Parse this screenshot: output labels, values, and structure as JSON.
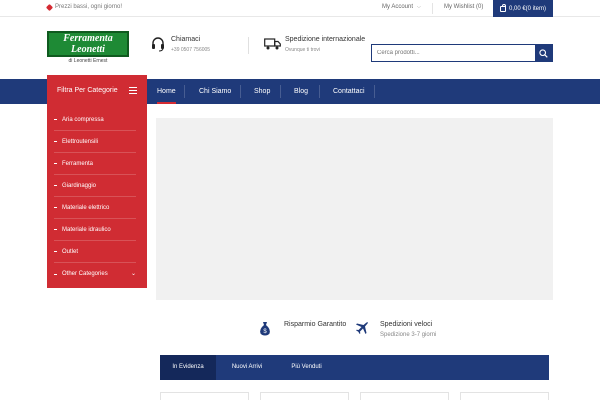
{
  "topbar": {
    "promo_text": "Prezzi bassi, ogni giorno!",
    "account_label": "My Account",
    "wishlist_label": "My Wishlist (0)",
    "cart_label": "0,00 €(0 item)"
  },
  "header": {
    "logo_line1": "Ferramenta",
    "logo_line2": "Leonetti",
    "logo_sub": "di Leonetti Ernest",
    "contact_title": "Chiamaci",
    "contact_phone": "+39 0507 756005",
    "shipping_title": "Spedizione internazionale",
    "shipping_sub": "Ovunque ti trovi",
    "search_placeholder": "Cerca prodotti..."
  },
  "nav": {
    "category_title": "Filtra Per Categorie",
    "items": [
      {
        "label": "Home"
      },
      {
        "label": "Chi Siamo"
      },
      {
        "label": "Shop"
      },
      {
        "label": "Blog"
      },
      {
        "label": "Contattaci"
      }
    ]
  },
  "categories": [
    {
      "label": "Aria compressa"
    },
    {
      "label": "Elettroutensili"
    },
    {
      "label": "Ferramenta"
    },
    {
      "label": "Giardinaggio"
    },
    {
      "label": "Materiale elettrico"
    },
    {
      "label": "Materiale idraulico"
    },
    {
      "label": "Outlet"
    },
    {
      "label": "Other Categories"
    }
  ],
  "features": [
    {
      "title": "Risparmio Garantito",
      "subtitle": ""
    },
    {
      "title": "Spedizioni veloci",
      "subtitle": "Spedizione 3-7 giorni"
    }
  ],
  "tabs": [
    {
      "label": "In Evidenza"
    },
    {
      "label": "Nuovi Arrivi"
    },
    {
      "label": "Più Venduti"
    }
  ],
  "colors": {
    "brand_blue": "#1f3a7a",
    "brand_red": "#d02c33",
    "logo_green": "#1e8a35"
  },
  "icons": {
    "promo": "tag-icon",
    "account": "chevron-down-icon",
    "cart": "shopping-bag-icon",
    "contact": "headset-icon",
    "shipping": "truck-icon",
    "search": "search-icon",
    "category_menu": "menu-icon",
    "feature_savings": "money-bag-icon",
    "feature_shipping": "airplane-icon"
  }
}
